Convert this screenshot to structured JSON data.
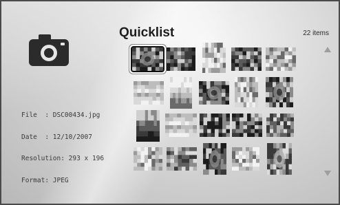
{
  "header": {
    "title": "Quicklist",
    "item_count": "22 items"
  },
  "file_info": {
    "file": "File  : DSC00434.jpg",
    "date": "Date  : 12/10/2007",
    "resolution": "Resolution: 293 x 196",
    "format": "Format: JPEG"
  },
  "icons": {
    "camera": "camera-icon",
    "scroll_up": "scroll-up-arrow",
    "scroll_down": "scroll-down-arrow"
  },
  "grid": {
    "selected_index": 0,
    "thumbnails": [
      {
        "tone": "dark-cat-portrait"
      },
      {
        "tone": "dark-grid"
      },
      {
        "tone": "light-texture"
      },
      {
        "tone": "dark-light-split"
      },
      {
        "tone": "light-grid"
      },
      {
        "tone": "light-horizontal"
      },
      {
        "tone": "light-sky-dark-ground"
      },
      {
        "tone": "dark-portrait"
      },
      {
        "tone": "light-soft"
      },
      {
        "tone": "dark-portrait-2"
      },
      {
        "tone": "dark-gradient"
      },
      {
        "tone": "light-horizontal-2"
      },
      {
        "tone": "dark-mixed"
      },
      {
        "tone": "dark-light-split-2"
      },
      {
        "tone": "mid-grid"
      },
      {
        "tone": "light-mixed"
      },
      {
        "tone": "mid-grid-2"
      },
      {
        "tone": "dark-portrait-3"
      },
      {
        "tone": "light-mixed-2"
      },
      {
        "tone": "mid-portrait"
      }
    ]
  }
}
